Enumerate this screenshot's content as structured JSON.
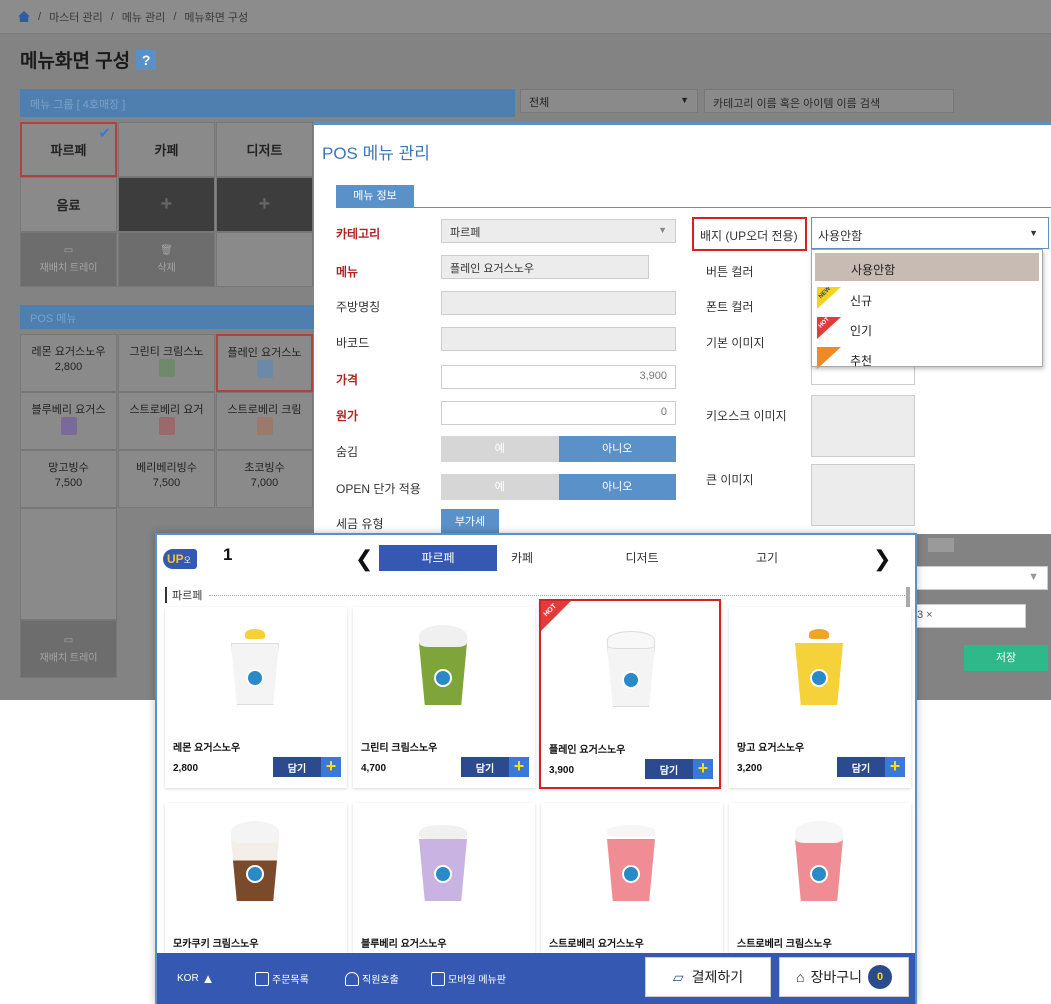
{
  "breadcrumb": [
    "마스터 관리",
    "/",
    "메뉴 관리",
    "/",
    "메뉴화면 구성"
  ],
  "page_title": "메뉴화면 구성",
  "help_label": "?",
  "group_header": "메뉴 그룹 [ 4호매장 ]",
  "filter_select": "전체",
  "search_placeholder": "카테고리 이름 혹은 아이템 이름 검색",
  "groups": [
    "파르페",
    "카페",
    "디저트",
    "음료"
  ],
  "tray_label": "재배치 트레이",
  "delete_label": "삭제",
  "pos_header": "POS 메뉴",
  "pos_items": [
    {
      "name": "레몬 요거스노우",
      "price": "2,800"
    },
    {
      "name": "그린티 크림스노",
      "price": ""
    },
    {
      "name": "플레인 요거스노",
      "price": ""
    },
    {
      "name": "블루베리 요거스",
      "price": ""
    },
    {
      "name": "스트로베리 요거",
      "price": ""
    },
    {
      "name": "스트로베리 크림",
      "price": ""
    },
    {
      "name": "망고빙수",
      "price": "7,500"
    },
    {
      "name": "베리베리빙수",
      "price": "7,500"
    },
    {
      "name": "초코빙수",
      "price": "7,000"
    }
  ],
  "modal": {
    "title": "POS 메뉴 관리",
    "tab": "메뉴 정보",
    "fields": {
      "category_label": "카테고리",
      "category_value": "파르페",
      "menu_label": "메뉴",
      "menu_value": "플레인 요거스노우",
      "kitchen_label": "주방명칭",
      "barcode_label": "바코드",
      "price_label": "가격",
      "price_value": "3,900",
      "cost_label": "원가",
      "cost_value": "0",
      "hide_label": "숨김",
      "open_label": "OPEN 단가 적용",
      "yes": "예",
      "no": "아니오",
      "tax_label": "세금 유형",
      "tax_value": "부가세"
    },
    "right": {
      "badge_label": "배지 (UP오더 전용)",
      "badge_value": "사용안함",
      "button_color": "버튼 컬러",
      "font_color": "폰트 컬러",
      "default_image": "기본 이미지",
      "kiosk_image": "키오스크 이미지",
      "large_image": "큰 이미지"
    },
    "dropdown": [
      "사용안함",
      "신규",
      "인기",
      "추천"
    ],
    "badge_texts": [
      "NEW",
      "HOT"
    ],
    "tag_fragment": "3 ×",
    "save": "저장"
  },
  "kiosk": {
    "logo": "UP",
    "logo_small": "오더",
    "table_no": "1",
    "tabs": [
      "파르페",
      "카페",
      "디저트",
      "고기"
    ],
    "section": "파르페",
    "add_label": "담기",
    "hot_label": "HOT",
    "products": [
      {
        "name": "레몬 요거스노우",
        "price": "2,800"
      },
      {
        "name": "그린티 크림스노우",
        "price": "4,700"
      },
      {
        "name": "플레인 요거스노우",
        "price": "3,900"
      },
      {
        "name": "망고 요거스노우",
        "price": "3,200"
      },
      {
        "name": "모카쿠키 크림스노우",
        "price": ""
      },
      {
        "name": "블루베리 요거스노우",
        "price": ""
      },
      {
        "name": "스트로베리 요거스노우",
        "price": ""
      },
      {
        "name": "스트로베리 크림스노우",
        "price": ""
      }
    ],
    "footer": {
      "lang": "KOR",
      "orders": "주문목록",
      "call": "직원호출",
      "mobile": "모바일 메뉴판",
      "pay": "결제하기",
      "cart": "장바구니",
      "cart_count": "0"
    }
  },
  "colors": {
    "accent": "#5b91c9",
    "kiosk_blue": "#3558b2",
    "highlight": "#d92121",
    "save": "#2fb98a"
  }
}
